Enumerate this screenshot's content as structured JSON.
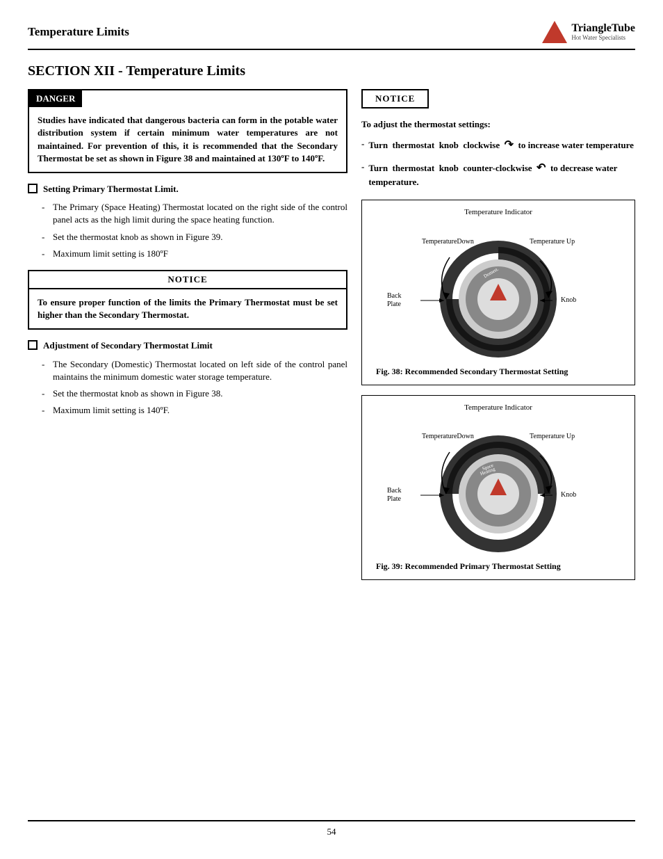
{
  "header": {
    "title": "Temperature Limits",
    "logo_brand": "TriangleTube",
    "logo_tagline": "Hot Water Specialists"
  },
  "section_heading": "SECTION XII - Temperature Limits",
  "danger": {
    "label": "DANGER",
    "content": "Studies have indicated that dangerous bacteria can form in the potable water distribution system if certain minimum water temperatures are not maintained. For prevention of this, it is recommended that the Secondary Thermostat be set as shown in Figure 38 and maintained at 130ºF to 140ºF."
  },
  "primary_thermostat": {
    "heading": "Setting  Primary Thermostat Limit.",
    "bullets": [
      "The Primary (Space Heating) Thermostat located on the right side of the control panel acts as the high limit during the space heating function.",
      "Set the thermostat knob as shown in Figure 39.",
      "Maximum limit setting is 180ºF"
    ]
  },
  "notice_left": {
    "label": "NOTICE",
    "content": "To ensure proper function of the limits the Primary Thermostat must be set higher than the Secondary Thermostat."
  },
  "secondary_thermostat": {
    "heading": "Adjustment of Secondary Thermostat Limit",
    "bullets": [
      "The Secondary (Domestic) Thermostat located on left side of the control panel maintains the minimum domestic water storage temperature.",
      "Set the thermostat knob as shown in Figure 38.",
      "Maximum limit setting is 140ºF."
    ]
  },
  "right_col": {
    "notice_tag": "NOTICE",
    "adjust_title": "To adjust the thermostat settings:",
    "instructions": [
      {
        "text": "Turn  thermostat  knob  clockwise         to increase water temperature",
        "arrow": "clockwise"
      },
      {
        "text": "Turn  thermostat  knob  counter-clockwise        to decrease water temperature.",
        "arrow": "counterclockwise"
      }
    ],
    "fig38_caption": "Fig. 38:   Recommended Secondary Thermostat Setting",
    "fig39_caption": "Fig. 39:   Recommended Primary Thermostat Setting"
  },
  "footer": {
    "page_number": "54"
  }
}
